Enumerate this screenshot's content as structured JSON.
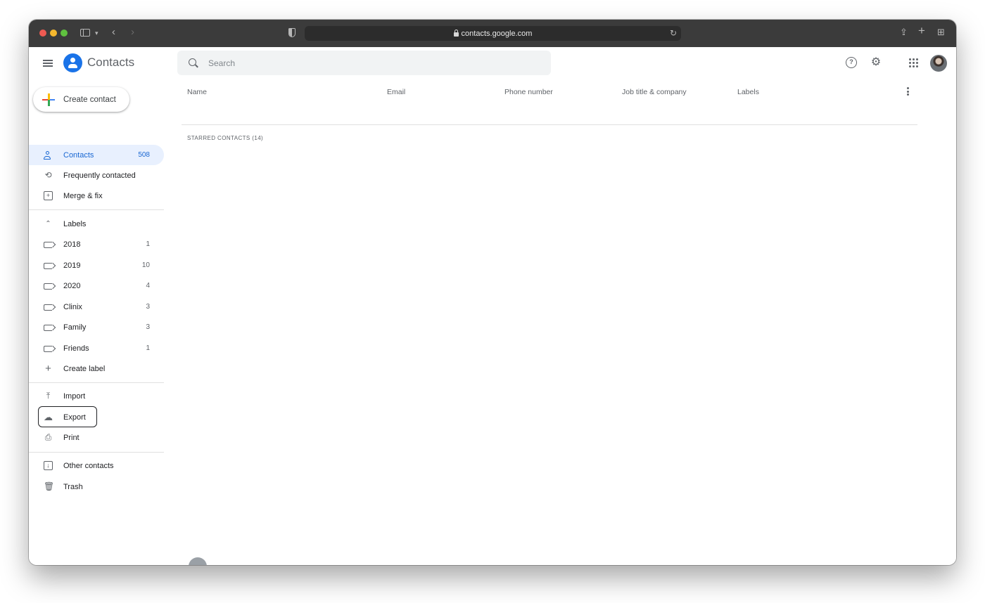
{
  "browser": {
    "url": "contacts.google.com"
  },
  "app": {
    "title": "Contacts",
    "search_placeholder": "Search",
    "create_contact": "Create contact"
  },
  "sidebar": {
    "primary": [
      {
        "label": "Contacts",
        "count": "508",
        "icon": "person-icon",
        "active": true
      },
      {
        "label": "Frequently contacted",
        "count": "",
        "icon": "history-icon"
      },
      {
        "label": "Merge & fix",
        "count": "",
        "icon": "merge-icon"
      }
    ],
    "labels_header": "Labels",
    "labels": [
      {
        "label": "2018",
        "count": "1"
      },
      {
        "label": "2019",
        "count": "10"
      },
      {
        "label": "2020",
        "count": "4"
      },
      {
        "label": "Clinix",
        "count": "3"
      },
      {
        "label": "Family",
        "count": "3"
      },
      {
        "label": "Friends",
        "count": "1"
      }
    ],
    "create_label": "Create label",
    "tools": [
      {
        "label": "Import",
        "icon": "upload-icon"
      },
      {
        "label": "Export",
        "icon": "cloud-upload-icon"
      },
      {
        "label": "Print",
        "icon": "print-icon"
      }
    ],
    "bottom": [
      {
        "label": "Other contacts",
        "icon": "archive-icon"
      },
      {
        "label": "Trash",
        "icon": "trash-icon"
      }
    ]
  },
  "table": {
    "columns": [
      "Name",
      "Email",
      "Phone number",
      "Job title & company",
      "Labels"
    ],
    "section_title": "STARRED CONTACTS (14)"
  },
  "colors": {
    "accent": "#1967d2",
    "active_bg": "#e8f0fe",
    "chrome": "#3b3b3b"
  }
}
